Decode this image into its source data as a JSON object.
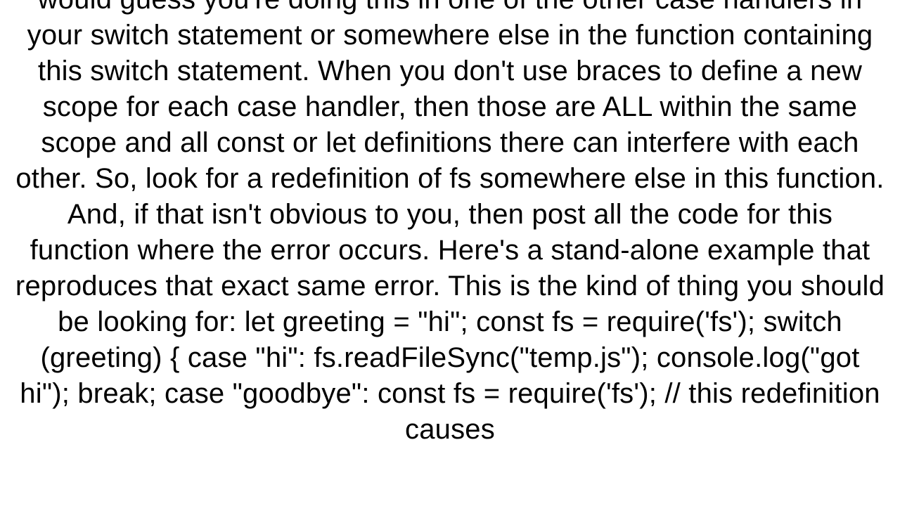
{
  "text": "would guess you're doing this in one of the other case handlers in your switch statement or somewhere else in the function containing this switch statement.  When you don't use braces to define a new scope for each case handler, then those are ALL within the same scope and all const or let definitions there can interfere with each other. So, look for a redefinition of fs somewhere else in this function.  And, if that isn't obvious to you, then post all the code for this function where the error occurs.  Here's a stand-alone example that reproduces that exact same error.  This is the kind of thing you should be looking for: let greeting = \"hi\"; const fs = require('fs');  switch (greeting) {     case \"hi\":         fs.readFileSync(\"temp.js\");         console.log(\"got hi\");         break;     case \"goodbye\":         const fs = require('fs');        // this redefinition causes"
}
